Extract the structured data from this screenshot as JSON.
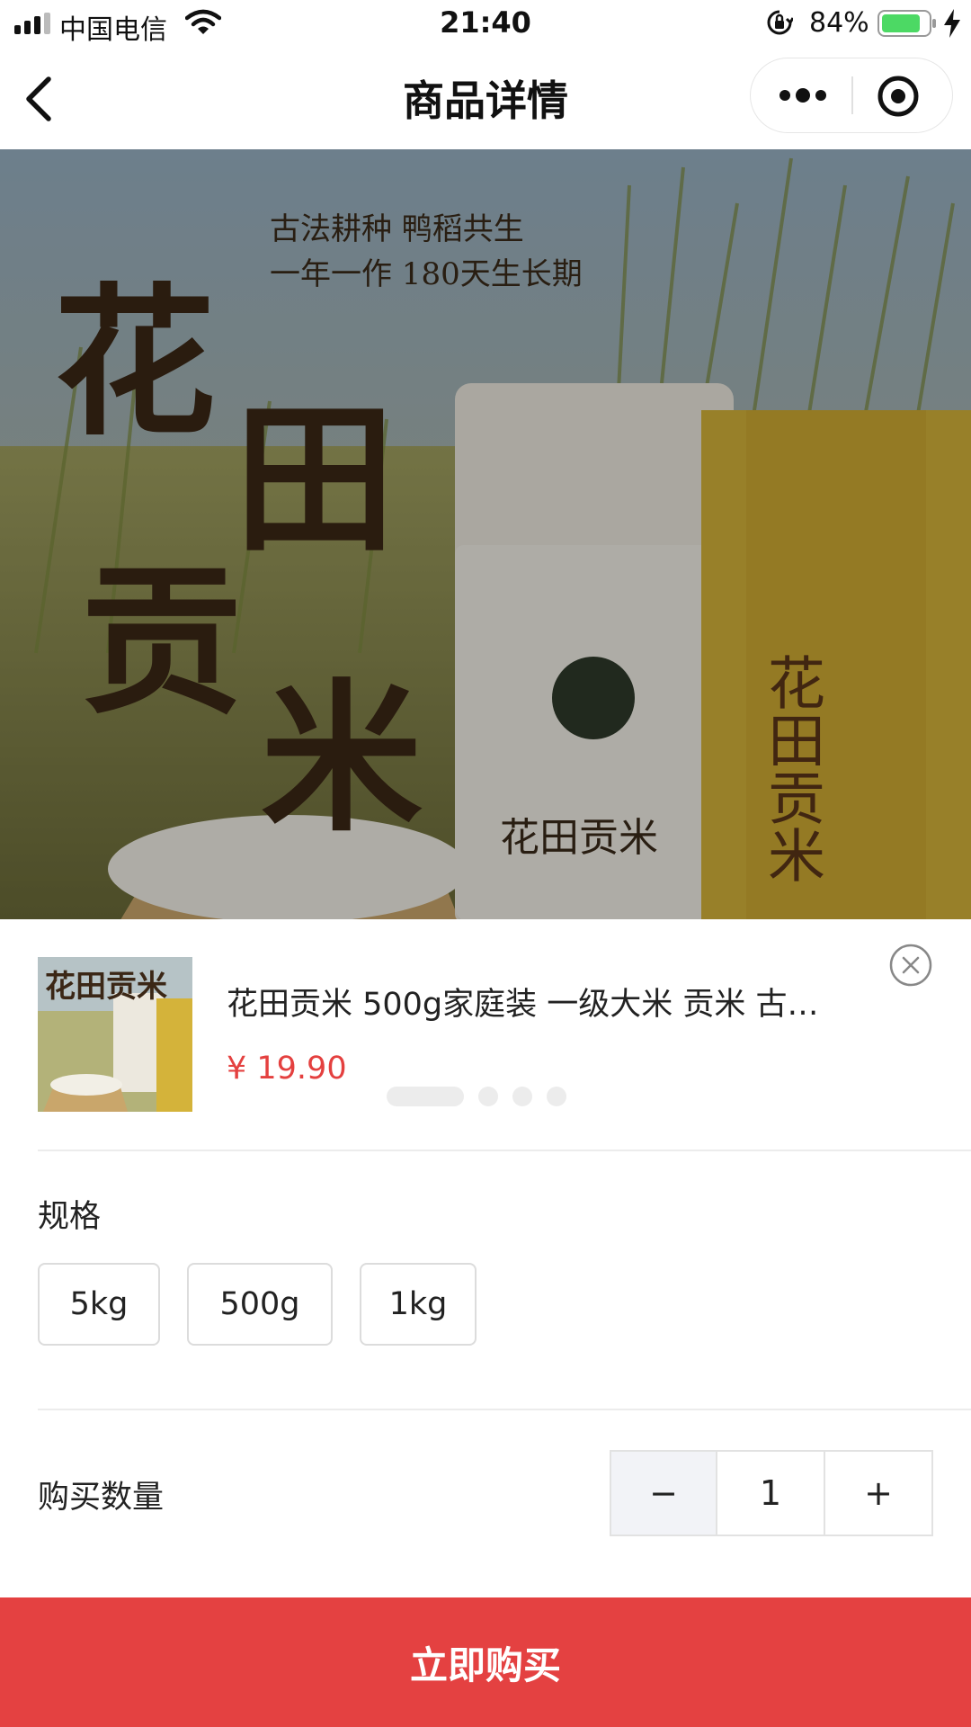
{
  "status_bar": {
    "carrier": "中国电信",
    "time": "21:40",
    "battery": "84%"
  },
  "nav": {
    "title": "商品详情"
  },
  "hero": {
    "brand_title": "花田贡米",
    "slogan_line1": "古法耕种 鸭稻共生",
    "slogan_line2": "一年一作 180天生长期",
    "bag_label": "花田贡米",
    "box_label": "花田贡米"
  },
  "product": {
    "name": "花田贡米 500g家庭装 一级大米 贡米 古…",
    "price": "¥ 19.90",
    "thumb_title": "花田贡米"
  },
  "spec": {
    "label": "规格",
    "options": [
      "5kg",
      "500g",
      "1kg"
    ]
  },
  "quantity": {
    "label": "购买数量",
    "minus": "−",
    "value": "1",
    "plus": "+"
  },
  "buy_button": "立即购买",
  "colors": {
    "accent": "#e44141",
    "price": "#e4403f"
  }
}
